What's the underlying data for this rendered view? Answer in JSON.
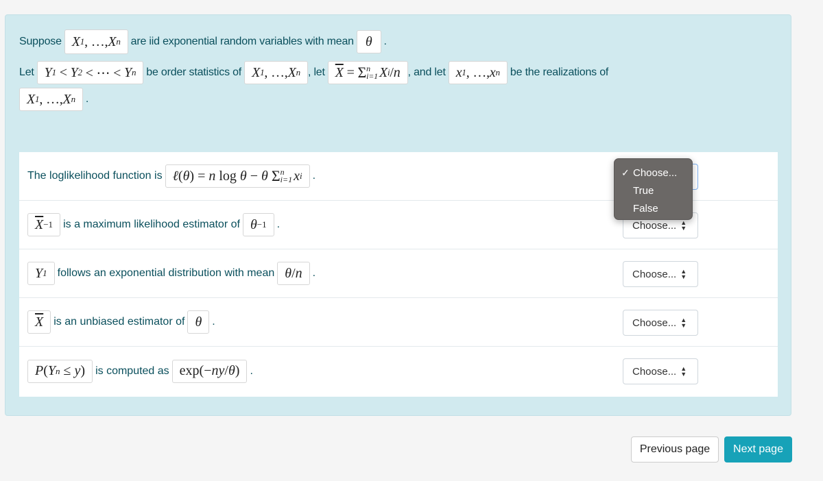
{
  "intro": {
    "line1": {
      "prefix": "Suppose",
      "math_vars": "X₁, …, Xₙ",
      "middle": "are iid exponential random variables with mean",
      "math_mean": "θ",
      "suffix": "."
    },
    "line2": {
      "prefix": "Let",
      "math_order": "Y₁ < Y₂ < ⋯ < Yₙ",
      "middle1": "be order statistics of",
      "math_vars": "X₁, …, Xₙ",
      "middle2": ", let",
      "math_xbar": "X̄ = Σⁿᵢ₌₁ Xᵢ/n",
      "middle3": ", and let",
      "math_realizations": "x₁, …, xₙ",
      "suffix": "be the realizations of"
    },
    "line3": {
      "math_vars": "X₁, …, Xₙ",
      "suffix": "."
    }
  },
  "questions": [
    {
      "pre_math": "",
      "text_before": "The loglikelihood function is",
      "math_a": "ℓ(θ) = n log θ − θ Σⁿᵢ₌₁ xᵢ",
      "text_after": "",
      "math_b": "",
      "end": ".",
      "select_value": "Choose..."
    },
    {
      "pre_math": "X̄⁻¹",
      "text_before": "is a maximum likelihood estimator of",
      "math_a": "θ⁻¹",
      "end": ".",
      "select_value": "Choose..."
    },
    {
      "pre_math": "Y₁",
      "text_before": "follows an exponential distribution with mean",
      "math_a": "θ/n",
      "end": ".",
      "select_value": "Choose..."
    },
    {
      "pre_math": "X̄",
      "text_before": "is an unbiased estimator of",
      "math_a": "θ",
      "end": ".",
      "select_value": "Choose..."
    },
    {
      "pre_math": "P(Yₙ ≤ y)",
      "text_before": "is computed as",
      "math_a": "exp(−ny/θ)",
      "end": ".",
      "select_value": "Choose..."
    }
  ],
  "dropdown": {
    "options": [
      "Choose...",
      "True",
      "False"
    ],
    "selected": "Choose...",
    "check_icon": "✓"
  },
  "nav": {
    "previous_label": "Previous page",
    "next_label": "Next page"
  },
  "colors": {
    "panel_bg": "#d1eaef",
    "text": "#0a4f5c",
    "next_button": "#17a2b8",
    "dropdown_bg": "#6b6866"
  }
}
